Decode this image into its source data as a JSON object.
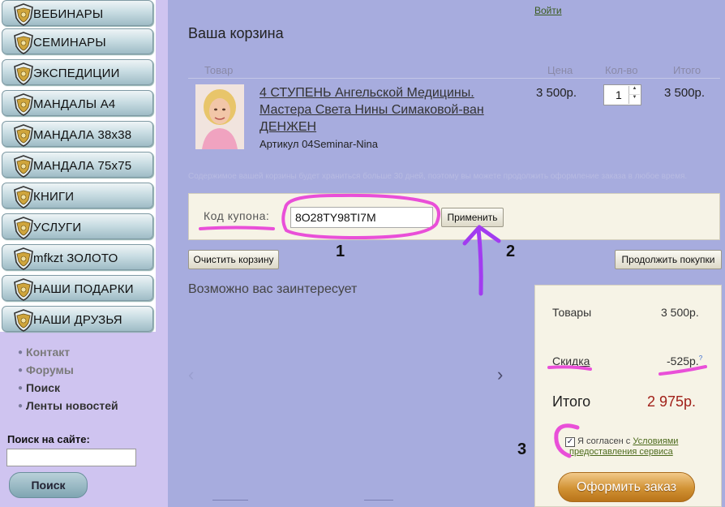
{
  "menu": {
    "items": [
      {
        "label": "ВЕБИНАРЫ"
      },
      {
        "label": "СЕМИНАРЫ"
      },
      {
        "label": "ЭКСПЕДИЦИИ"
      },
      {
        "label": "МАНДАЛЫ А4"
      },
      {
        "label": "МАНДАЛА 38х38"
      },
      {
        "label": "МАНДАЛА 75х75"
      },
      {
        "label": "КНИГИ"
      },
      {
        "label": "УСЛУГИ"
      },
      {
        "label": "mfkzt ЗОЛОТО"
      },
      {
        "label": "НАШИ ПОДАРКИ"
      },
      {
        "label": "НАШИ ДРУЗЬЯ"
      }
    ]
  },
  "links": {
    "contact": "Контакт",
    "forums": "Форумы",
    "search": "Поиск",
    "news": "Ленты новостей"
  },
  "search": {
    "label": "Поиск на сайте:",
    "value": "",
    "button": "Поиск"
  },
  "header": {
    "login": "Войти"
  },
  "cart": {
    "title": "Ваша корзина",
    "columns": {
      "product": "Товар",
      "price": "Цена",
      "qty": "Кол-во",
      "total": "Итого"
    },
    "item": {
      "name": "4 СТУПЕНЬ Ангельской Медицины. Мастера Света Нины Симаковой-ван ДЕНЖЕН",
      "sku": "Артикул 04Seminar-Nina",
      "price": "3 500р.",
      "qty": "1",
      "total": "3 500р."
    },
    "notice": "Содержимое вашей корзины будет храниться больше 30 дней, поэтому вы можете продолжить оформление заказа в любое время.",
    "coupon_label": "Код купона:",
    "coupon_value": "8O28TY98TI7M",
    "apply_button": "Применить",
    "clear_button": "Очистить корзину",
    "continue_button": "Продолжить покупки"
  },
  "related": {
    "title": "Возможно вас заинтересует",
    "prev": "‹",
    "next": "›"
  },
  "summary": {
    "goods_label": "Товары",
    "goods_value": "3 500р.",
    "discount_label": "Скидка",
    "discount_value": "-525р.",
    "discount_help": "?",
    "total_label": "Итого",
    "total_value": "2 975р.",
    "agree_text": "Я согласен с",
    "agree_link": "Условиями",
    "agree_link2": "предоставления сервиса",
    "order_button": "Оформить заказ"
  },
  "annotations": {
    "n1": "1",
    "n2": "2",
    "n3": "3"
  },
  "colors": {
    "marker": "#e94fd8",
    "arrow": "#a23cf0",
    "accent_total": "#a1211a",
    "order_button": "#d19234"
  }
}
